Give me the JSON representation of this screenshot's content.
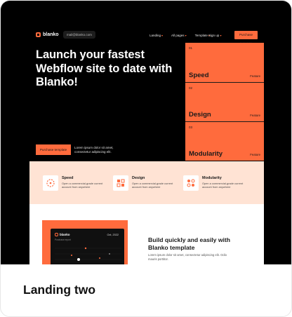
{
  "card": {
    "caption": "Landing two"
  },
  "nav": {
    "brand": "blanko",
    "email": "mail@blanko.com",
    "links": [
      "Landing",
      "All pages",
      "Template"
    ],
    "sign_up": "Sign up",
    "cta": "Purchase template"
  },
  "hero": {
    "title": "Launch your fastest Webflow site to date with Blanko!",
    "cta": "Purchase template",
    "description": "Lorem ipsum dolor sit amet, consectetur adipiscing elit."
  },
  "feature_panel": [
    {
      "number": "01",
      "name": "Speed",
      "tag": "Feature"
    },
    {
      "number": "02",
      "name": "Design",
      "tag": "Feature"
    },
    {
      "number": "03",
      "name": "Modularity",
      "tag": "Feature"
    }
  ],
  "features": [
    {
      "title": "Speed",
      "text": "Open a commercial-grade current account from anywhere"
    },
    {
      "title": "Design",
      "text": "Open a commercial-grade current account from anywhere"
    },
    {
      "title": "Modularity",
      "text": "Open a commercial-grade current account from anywhere"
    }
  ],
  "lower": {
    "dashboard_brand": "blanko",
    "dashboard_sub": "Purchase report",
    "dashboard_date": "Oct, 2022",
    "title": "Build quickly and easily with Blanko template",
    "text": "Lorem ipsum dolor sit amet, consectetur adipiscing elit. Odio mauris porttitor."
  },
  "colors": {
    "accent": "#ff6b3d",
    "band": "#ffe3d4",
    "dark": "#000000"
  },
  "icons": [
    "logo-mark-icon",
    "chevron-down-icon",
    "speed-icon",
    "design-icon",
    "modularity-icon"
  ]
}
